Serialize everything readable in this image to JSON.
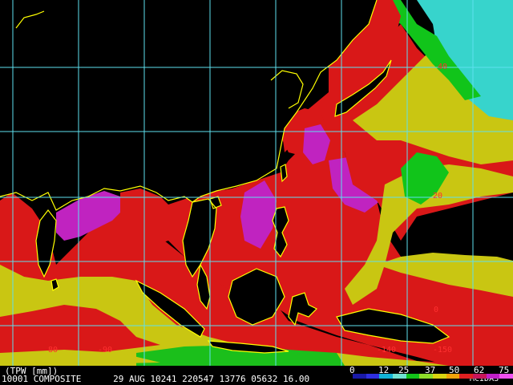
{
  "product": {
    "field_label": "(TPW [mm])",
    "line_text": "10001 COMPOSITE      29 AUG 10241 220547 13776 05632 16.00",
    "source": "McIDAS"
  },
  "grid": {
    "latitude_labels": [
      "40",
      "20",
      "0"
    ],
    "longitude_labels": [
      "80",
      "-90",
      "-140",
      "-150"
    ]
  },
  "colorbar": {
    "ticks": [
      "0",
      "12",
      "25",
      "37",
      "50",
      "62",
      "75"
    ],
    "colors": [
      "#1a1aa8",
      "#2f2fe0",
      "#12b4d8",
      "#6fe2d2",
      "#12c31a",
      "#8edd2a",
      "#d9d411",
      "#f0a30a",
      "#e02020",
      "#c8165a",
      "#c020c8",
      "#f050f0"
    ]
  },
  "colors": {
    "background": "#000000",
    "grid_line": "#5ee0ee",
    "coastline": "#ffff00",
    "label_red": "#ff3030",
    "land_fill": "#000000",
    "moist": "#dd1a1a",
    "very_moist": "#c023c0",
    "moderate": "#c9c612",
    "dry": "#11c41a",
    "very_dry": "#37d4cc"
  }
}
